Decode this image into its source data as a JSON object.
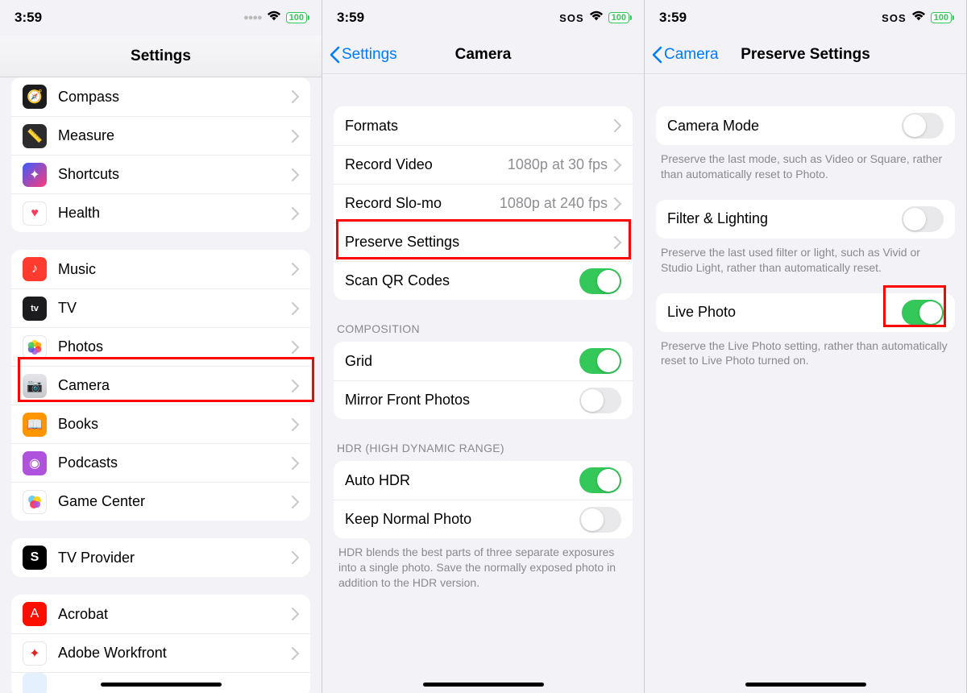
{
  "status": {
    "time": "3:59",
    "battery": "100",
    "sos": "SOS"
  },
  "phone1": {
    "title": "Settings",
    "groupA": [
      {
        "label": "Compass"
      },
      {
        "label": "Measure"
      },
      {
        "label": "Shortcuts"
      },
      {
        "label": "Health"
      }
    ],
    "groupB": [
      {
        "label": "Music"
      },
      {
        "label": "TV"
      },
      {
        "label": "Photos"
      },
      {
        "label": "Camera"
      },
      {
        "label": "Books"
      },
      {
        "label": "Podcasts"
      },
      {
        "label": "Game Center"
      }
    ],
    "groupC": [
      {
        "label": "TV Provider"
      }
    ],
    "groupD": [
      {
        "label": "Acrobat"
      },
      {
        "label": "Adobe Workfront"
      }
    ]
  },
  "phone2": {
    "back": "Settings",
    "title": "Camera",
    "group1": [
      {
        "label": "Formats",
        "detail": ""
      },
      {
        "label": "Record Video",
        "detail": "1080p at 30 fps"
      },
      {
        "label": "Record Slo-mo",
        "detail": "1080p at 240 fps"
      },
      {
        "label": "Preserve Settings",
        "detail": ""
      },
      {
        "label": "Scan QR Codes",
        "toggle": true
      }
    ],
    "section2_header": "COMPOSITION",
    "group2": [
      {
        "label": "Grid",
        "toggle": true
      },
      {
        "label": "Mirror Front Photos",
        "toggle": false
      }
    ],
    "section3_header": "HDR (HIGH DYNAMIC RANGE)",
    "group3": [
      {
        "label": "Auto HDR",
        "toggle": true
      },
      {
        "label": "Keep Normal Photo",
        "toggle": false
      }
    ],
    "section3_footer": "HDR blends the best parts of three separate exposures into a single photo. Save the normally exposed photo in addition to the HDR version."
  },
  "phone3": {
    "back": "Camera",
    "title": "Preserve Settings",
    "rows": [
      {
        "label": "Camera Mode",
        "toggle": false,
        "footer": "Preserve the last mode, such as Video or Square, rather than automatically reset to Photo."
      },
      {
        "label": "Filter & Lighting",
        "toggle": false,
        "footer": "Preserve the last used filter or light, such as Vivid or Studio Light, rather than automatically reset."
      },
      {
        "label": "Live Photo",
        "toggle": true,
        "footer": "Preserve the Live Photo setting, rather than automatically reset to Live Photo turned on."
      }
    ]
  }
}
